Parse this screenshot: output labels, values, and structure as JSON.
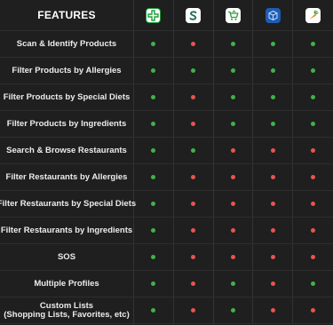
{
  "header": {
    "title": "FEATURES",
    "apps": [
      {
        "icon": "green-cross-logo-icon"
      },
      {
        "icon": "letter-s-logo-icon"
      },
      {
        "icon": "shopping-cart-logo-icon"
      },
      {
        "icon": "blue-cube-logo-icon"
      },
      {
        "icon": "carrot-logo-icon"
      }
    ]
  },
  "colors": {
    "yes": "#3fb24b",
    "no": "#e8534f"
  },
  "rows": [
    {
      "feature": "Scan & Identify Products",
      "support": [
        true,
        false,
        true,
        true,
        true
      ]
    },
    {
      "feature": "Filter Products by Allergies",
      "support": [
        true,
        true,
        true,
        true,
        true
      ]
    },
    {
      "feature": "Filter Products by Special Diets",
      "support": [
        true,
        false,
        true,
        true,
        true
      ]
    },
    {
      "feature": "Filter Products by Ingredients",
      "support": [
        true,
        false,
        true,
        true,
        true
      ]
    },
    {
      "feature": "Search & Browse Restaurants",
      "support": [
        true,
        true,
        false,
        false,
        false
      ]
    },
    {
      "feature": "Filter Restaurants by Allergies",
      "support": [
        true,
        false,
        false,
        false,
        false
      ]
    },
    {
      "feature": "Filter Restaurants by Special Diets",
      "support": [
        true,
        false,
        false,
        false,
        false
      ]
    },
    {
      "feature": "Filter Restaurants by Ingredients",
      "support": [
        true,
        false,
        false,
        false,
        false
      ]
    },
    {
      "feature": "SOS",
      "support": [
        true,
        false,
        false,
        false,
        false
      ]
    },
    {
      "feature": "Multiple Profiles",
      "support": [
        true,
        false,
        true,
        false,
        true
      ]
    },
    {
      "feature": "Custom Lists\n(Shopping Lists, Favorites, etc)",
      "support": [
        true,
        false,
        true,
        false,
        false
      ]
    }
  ]
}
